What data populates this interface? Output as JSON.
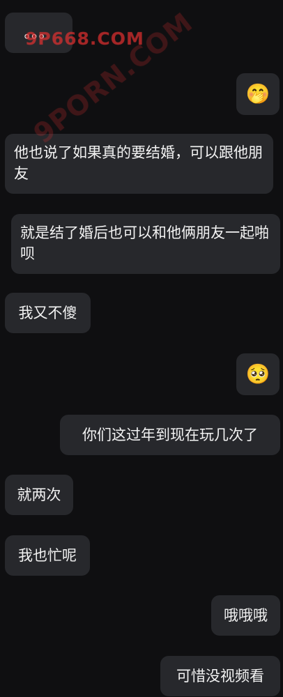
{
  "messages": {
    "m1": "。。。",
    "m2_emoji": "🤭",
    "m3": "他也说了如果真的要结婚，可以跟他朋友",
    "m4": "就是结了婚后也可以和他俩朋友一起啪呗",
    "m5": "我又不傻",
    "m6_emoji": "🥺",
    "m7": "你们这过年到现在玩几次了",
    "m8": "就两次",
    "m9": "我也忙呢",
    "m10": "哦哦哦",
    "m11": "可惜没视频看"
  },
  "watermarks": {
    "top": "9P668.COM",
    "diagonal": "9PORN.COM"
  }
}
